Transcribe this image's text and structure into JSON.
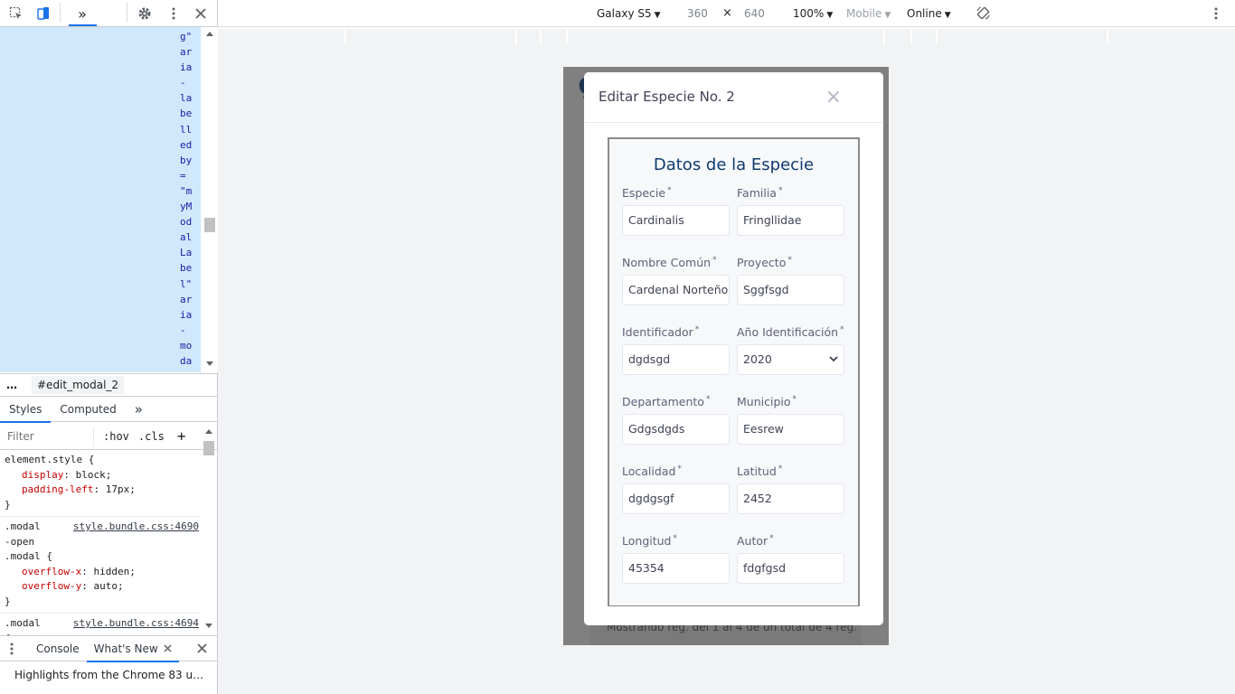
{
  "devtools": {
    "elements_text_lines": [
      "g\"",
      "ar",
      "ia",
      "-",
      "la",
      "be",
      "ll",
      "ed",
      "by",
      "=",
      "\"m",
      "yM",
      "od",
      "al",
      "La",
      "be",
      "l\"",
      "ar",
      "ia",
      "-",
      "mo",
      "da"
    ],
    "breadcrumb": {
      "dots": "…",
      "node": "#edit_modal_2"
    },
    "styles_tabs": {
      "styles": "Styles",
      "computed": "Computed",
      "more": "»"
    },
    "filter_placeholder": "Filter",
    "hov": ":hov",
    "cls": ".cls",
    "plus": "+",
    "rules": [
      {
        "selector": "element.style {",
        "source": "",
        "decls": [
          {
            "name": "display",
            "value": "block;"
          },
          {
            "name": "padding-left",
            "value": "17px;"
          }
        ],
        "close": "}"
      },
      {
        "selector": ".modal\n-open\n.modal {",
        "source": "style.bundle.css:4690",
        "decls": [
          {
            "name": "overflow-x",
            "value": "hidden;"
          },
          {
            "name": "overflow-y",
            "value": "auto;"
          }
        ],
        "close": "}"
      },
      {
        "selector": ".modal\n{",
        "source": "style.bundle.css:4694",
        "decls": [],
        "close": ""
      }
    ],
    "drawer_tabs": {
      "console": "Console",
      "whats_new": "What's New"
    },
    "drawer_content": "Highlights from the Chrome 83 u…"
  },
  "device_toolbar": {
    "device": "Galaxy S5",
    "width": "360",
    "times": "×",
    "height": "640",
    "zoom": "100%",
    "mode": "Mobile",
    "network": "Online"
  },
  "page": {
    "footer_text": "Mostrando reg. del 1 al 4 de un total de 4 reg."
  },
  "modal": {
    "title": "Editar Especie No. 2",
    "close": "×",
    "heading": "Datos de la Especie",
    "required_mark": "*",
    "fields": [
      {
        "label": "Especie",
        "value": "Cardinalis"
      },
      {
        "label": "Familia",
        "value": "Fringllidae"
      },
      {
        "label": "Nombre Común",
        "value": "Cardenal Norteño"
      },
      {
        "label": "Proyecto",
        "value": "Sggfsgd"
      },
      {
        "label": "Identificador",
        "value": "dgdsgd"
      },
      {
        "label": "Año Identificación",
        "value": "2020"
      },
      {
        "label": "Departamento",
        "value": "Gdgsdgds"
      },
      {
        "label": "Municipio",
        "value": "Eesrew"
      },
      {
        "label": "Localidad",
        "value": "dgdgsgf"
      },
      {
        "label": "Latitud",
        "value": "2452"
      },
      {
        "label": "Longitud",
        "value": "45354"
      },
      {
        "label": "Autor",
        "value": "fdgfgsd"
      }
    ]
  },
  "colors": {
    "accent": "#1a73e8",
    "heading": "#0f3b6e",
    "elements_selection": "#cfe8fc",
    "device_backdrop": "#808080"
  }
}
